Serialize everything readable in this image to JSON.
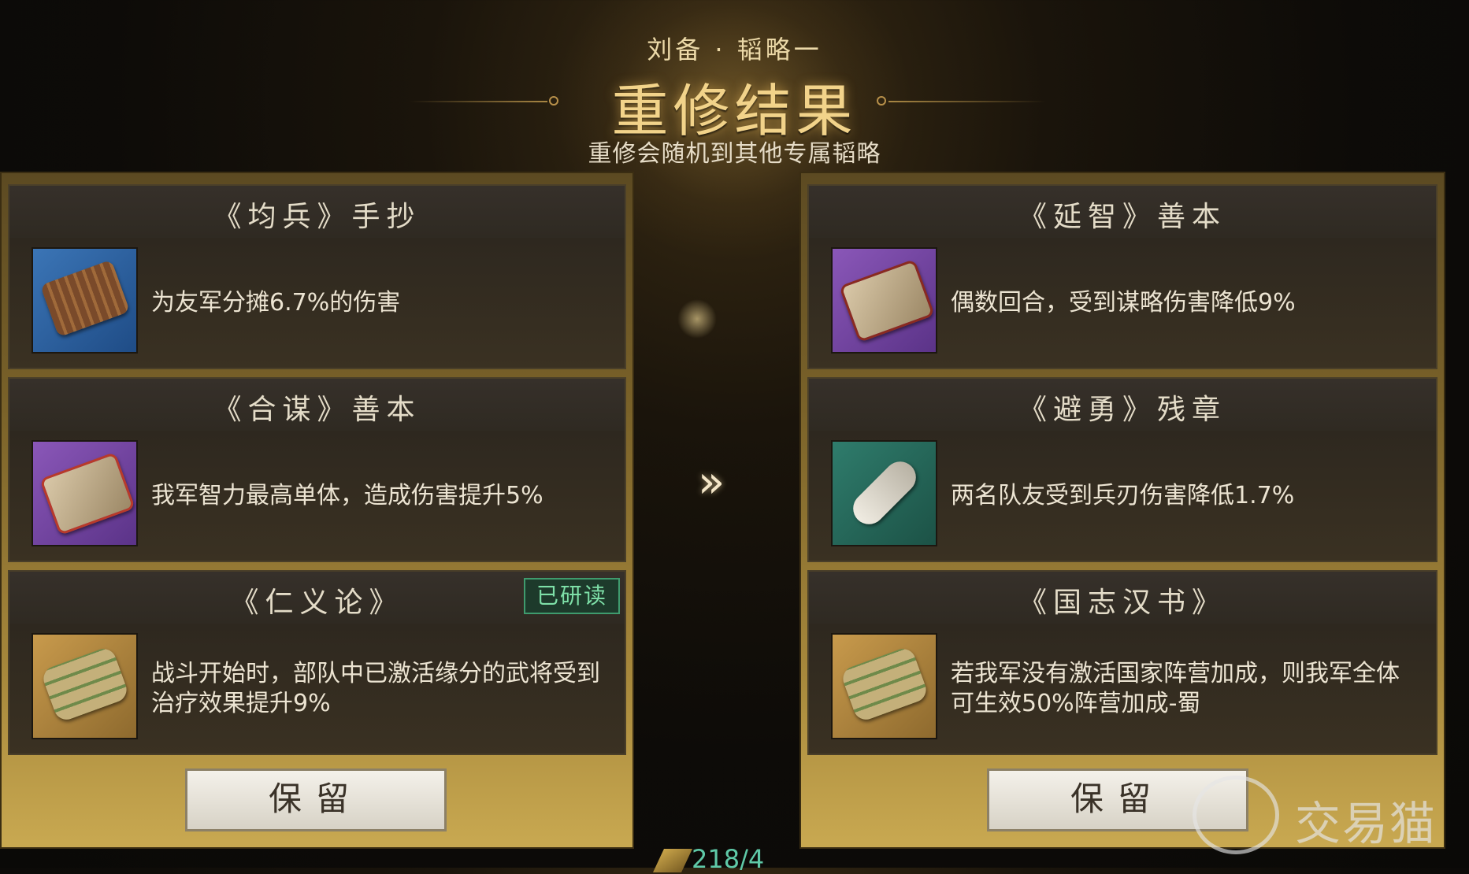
{
  "header": {
    "subtitle": "刘备 · 韬略一",
    "title": "重修结果",
    "note": "重修会随机到其他专属韬略"
  },
  "left": {
    "cards": [
      {
        "title": "《均兵》手抄",
        "icon": "bamboo-scroll-icon",
        "desc": "为友军分摊6.7%的伤害",
        "rarity_color": "#2f64a8"
      },
      {
        "title": "《合谋》善本",
        "icon": "wrapped-book-icon",
        "desc": "我军智力最高单体，造成伤害提升5%",
        "rarity_color": "#7a47a8"
      },
      {
        "title": "《仁义论》",
        "icon": "scroll-bundle-icon",
        "desc": "战斗开始时，部队中已激活缘分的武将受到治疗效果提升9%",
        "rarity_color": "#b08a40",
        "badge": "已研读"
      }
    ],
    "button": "保留"
  },
  "right": {
    "cards": [
      {
        "title": "《延智》善本",
        "icon": "open-book-icon",
        "desc": "偶数回合，受到谋略伤害降低9%",
        "rarity_color": "#7a47a8"
      },
      {
        "title": "《避勇》残章",
        "icon": "paper-scroll-icon",
        "desc": "两名队友受到兵刃伤害降低1.7%",
        "rarity_color": "#2f7c6c"
      },
      {
        "title": "《国志汉书》",
        "icon": "scroll-bundle-icon",
        "desc": "若我军没有激活国家阵营加成，则我军全体可生效50%阵营加成-蜀",
        "rarity_color": "#b08a40"
      }
    ],
    "button": "保留"
  },
  "arrow": "»",
  "counter": "218/4",
  "watermark": "交易猫"
}
